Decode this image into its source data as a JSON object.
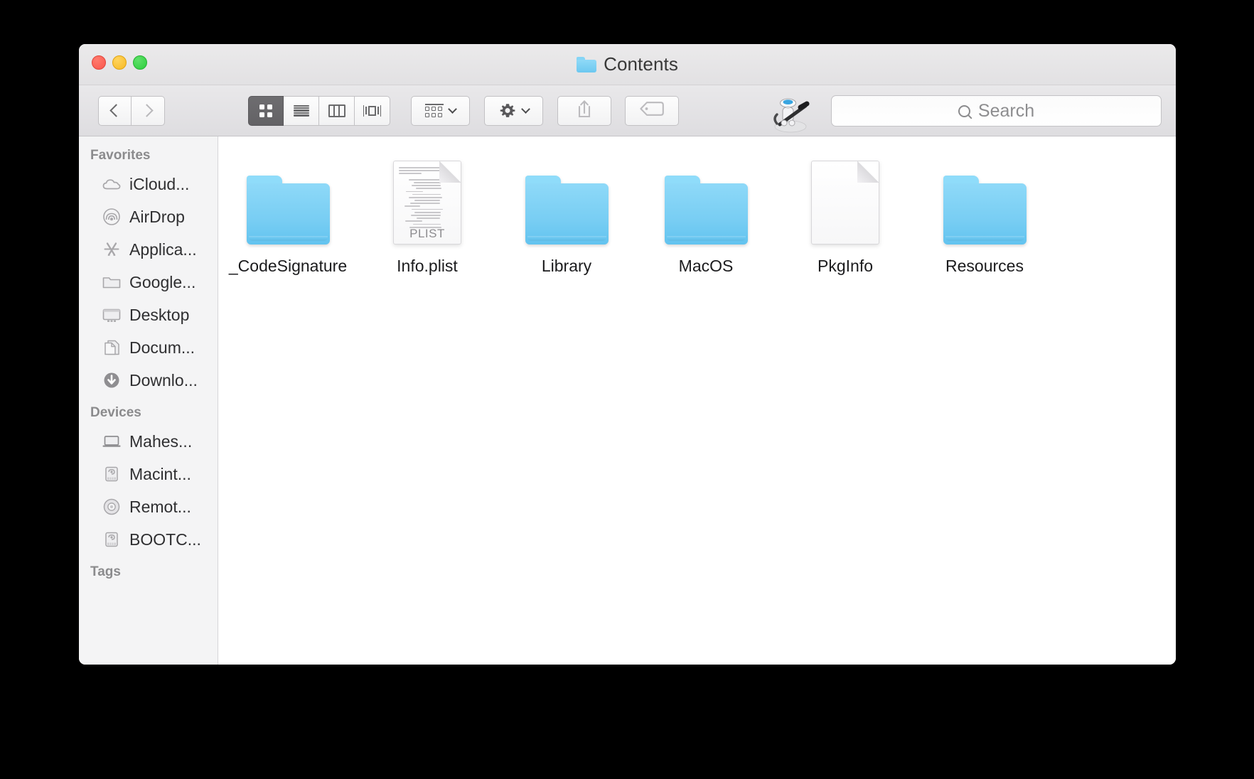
{
  "window": {
    "title": "Contents",
    "title_icon": "folder-icon",
    "traffic_lights": [
      {
        "name": "close",
        "color": "#f9564c"
      },
      {
        "name": "minimize",
        "color": "#f7b924"
      },
      {
        "name": "zoom",
        "color": "#2cce3c"
      }
    ]
  },
  "toolbar": {
    "back_label": "Back",
    "forward_label": "Forward",
    "view_modes": [
      {
        "name": "icon-view",
        "icon": "grid-icon",
        "active": true
      },
      {
        "name": "list-view",
        "icon": "list-icon",
        "active": false
      },
      {
        "name": "column-view",
        "icon": "columns-icon",
        "active": false
      },
      {
        "name": "coverflow-view",
        "icon": "coverflow-icon",
        "active": false
      }
    ],
    "arrange_label": "Arrange",
    "arrange_icon": "arrange-icon",
    "action_label": "Action",
    "action_icon": "gear-icon",
    "share_label": "Share",
    "share_icon": "share-icon",
    "tag_label": "Tags",
    "tag_icon": "tag-icon",
    "automator_icon": "automator-robot-icon"
  },
  "search": {
    "placeholder": "Search",
    "value": "",
    "icon": "search-icon"
  },
  "sidebar": {
    "sections": [
      {
        "header": "Favorites",
        "items": [
          {
            "label": "iCloud...",
            "icon": "icloud-icon"
          },
          {
            "label": "AirDrop",
            "icon": "airdrop-icon"
          },
          {
            "label": "Applica...",
            "icon": "applications-icon"
          },
          {
            "label": "Google...",
            "icon": "folder-icon"
          },
          {
            "label": "Desktop",
            "icon": "desktop-icon"
          },
          {
            "label": "Docum...",
            "icon": "documents-icon"
          },
          {
            "label": "Downlo...",
            "icon": "downloads-icon"
          }
        ]
      },
      {
        "header": "Devices",
        "items": [
          {
            "label": "Mahes...",
            "icon": "laptop-icon"
          },
          {
            "label": "Macint...",
            "icon": "harddisk-icon"
          },
          {
            "label": "Remot...",
            "icon": "optical-disc-icon"
          },
          {
            "label": "BOOTC...",
            "icon": "harddisk-icon"
          }
        ]
      },
      {
        "header": "Tags",
        "items": []
      }
    ]
  },
  "content": {
    "files": [
      {
        "name": "_CodeSignature",
        "kind": "folder"
      },
      {
        "name": "Info.plist",
        "kind": "plist"
      },
      {
        "name": "Library",
        "kind": "folder"
      },
      {
        "name": "MacOS",
        "kind": "folder"
      },
      {
        "name": "PkgInfo",
        "kind": "document"
      },
      {
        "name": "Resources",
        "kind": "folder"
      }
    ],
    "plist_badge": "PLIST"
  },
  "colors": {
    "folder_blue": "#77cdf3",
    "titlebar": "#e6e5e7",
    "sidebar_bg": "#f4f4f5",
    "content_bg": "#ffffff",
    "selection": "#6e6d70"
  }
}
